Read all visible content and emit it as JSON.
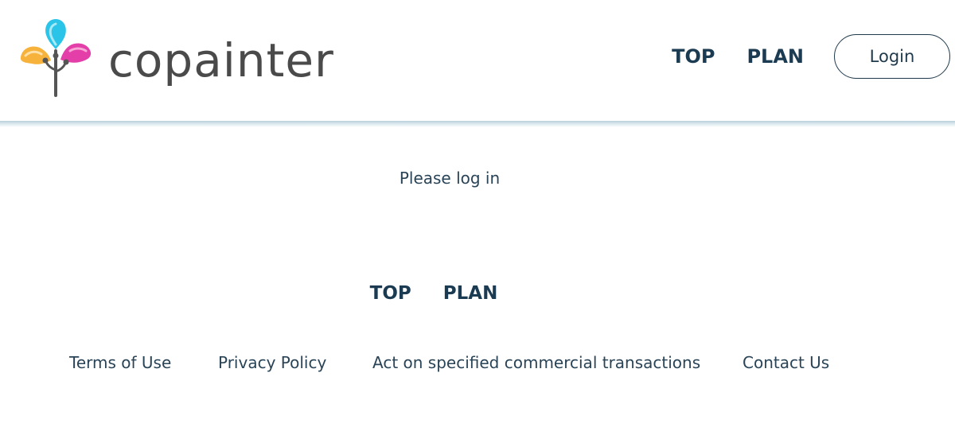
{
  "brand": {
    "name": "copainter",
    "colors": {
      "leaf_top": "#29c4e8",
      "leaf_left": "#f6b23a",
      "leaf_right": "#e43fa8",
      "stem": "#555555",
      "text": "#4a4a4a"
    }
  },
  "header": {
    "nav": [
      {
        "label": "TOP"
      },
      {
        "label": "PLAN"
      }
    ],
    "login_label": "Login"
  },
  "main": {
    "message": "Please log in"
  },
  "footer": {
    "nav": [
      {
        "label": "TOP"
      },
      {
        "label": "PLAN"
      }
    ],
    "links": [
      {
        "label": "Terms of Use"
      },
      {
        "label": "Privacy Policy"
      },
      {
        "label": "Act on specified commercial transactions"
      },
      {
        "label": "Contact Us"
      }
    ]
  },
  "theme": {
    "accent": "#1b3b52",
    "header_shadow": "#b9d0da"
  }
}
